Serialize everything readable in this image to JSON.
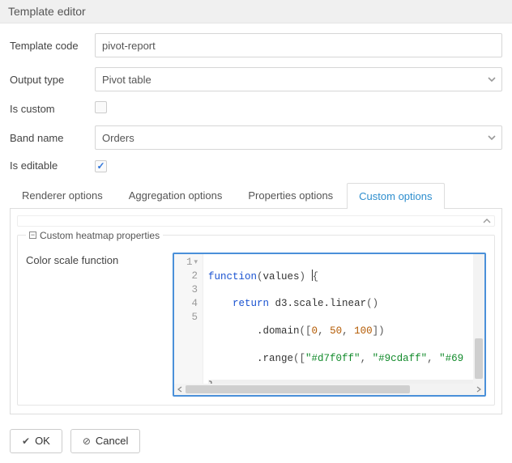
{
  "window": {
    "title": "Template editor"
  },
  "form": {
    "template_code": {
      "label": "Template code",
      "value": "pivot-report"
    },
    "output_type": {
      "label": "Output type",
      "value": "Pivot table"
    },
    "is_custom": {
      "label": "Is custom",
      "checked": false
    },
    "band_name": {
      "label": "Band name",
      "value": "Orders"
    },
    "is_editable": {
      "label": "Is editable",
      "checked": true
    }
  },
  "tabs": [
    {
      "label": "Renderer options",
      "active": false
    },
    {
      "label": "Aggregation options",
      "active": false
    },
    {
      "label": "Properties options",
      "active": false
    },
    {
      "label": "Custom options",
      "active": true
    }
  ],
  "fieldset": {
    "legend": "Custom heatmap properties",
    "color_scale_label": "Color scale function"
  },
  "code": {
    "lines": [
      "function(values) {",
      "    return d3.scale.linear()",
      "        .domain([0, 50, 100])",
      "        .range([\"#d7f0ff\", \"#9cdaff\", \"#69",
      "}"
    ],
    "tokens": {
      "kw_function": "function",
      "kw_return": "return",
      "id_d3scalelinear": "d3.scale.linear",
      "id_domain": ".domain",
      "id_range": ".range",
      "n0": "0",
      "n50": "50",
      "n100": "100",
      "s1": "\"#d7f0ff\"",
      "s2": "\"#9cdaff\"",
      "s3": "\"#69"
    }
  },
  "buttons": {
    "ok": "OK",
    "cancel": "Cancel"
  }
}
